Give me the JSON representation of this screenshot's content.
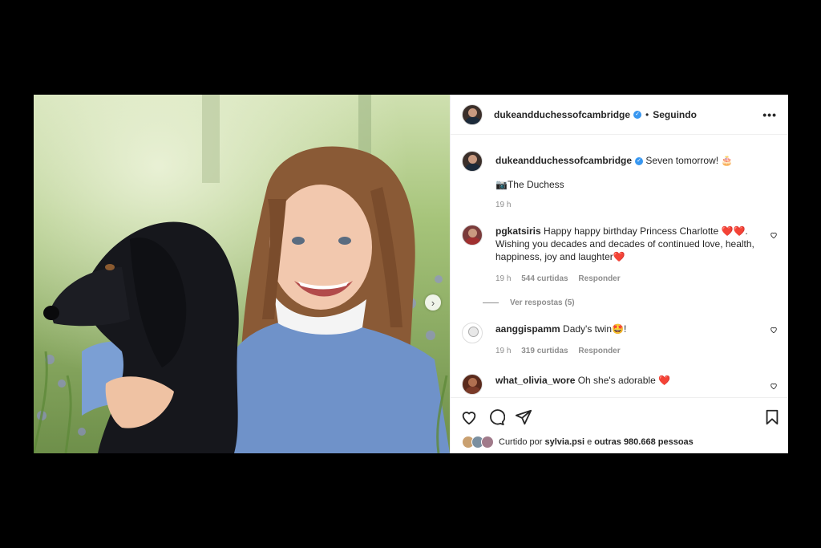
{
  "post": {
    "account": "dukeandduchessofcambridge",
    "follow_status": "Seguindo",
    "more_label": "•••"
  },
  "caption": {
    "username": "dukeandduchessofcambridge",
    "text": "Seven tomorrow! 🎂",
    "credit": "📷The Duchess",
    "time": "19 h"
  },
  "comments": [
    {
      "username": "pgkatsiris",
      "text": "Happy happy birthday Princess Charlotte ❤️❤️. Wishing you decades and decades of continued love, health, happiness, joy and laughter❤️",
      "time": "19 h",
      "likes": "544 curtidas",
      "reply": "Responder",
      "view_replies": "Ver respostas (5)"
    },
    {
      "username": "aanggispamm",
      "text": "Dady's twin🤩!",
      "time": "19 h",
      "likes": "319 curtidas",
      "reply": "Responder"
    },
    {
      "username": "what_olivia_wore",
      "text": "Oh she's adorable ❤️"
    }
  ],
  "likes_summary": {
    "prefix": "Curtido por ",
    "user": "sylvia.psi",
    "middle": " e ",
    "others": "outras 980.668 pessoas"
  },
  "icons": {
    "like": "heart-icon",
    "comment": "comment-icon",
    "share": "paper-plane-icon",
    "save": "bookmark-icon",
    "next": "chevron-right-icon"
  },
  "colors": {
    "verified": "#3897f0",
    "heart": "#ed4956",
    "meta_text": "#8e8e8e"
  }
}
